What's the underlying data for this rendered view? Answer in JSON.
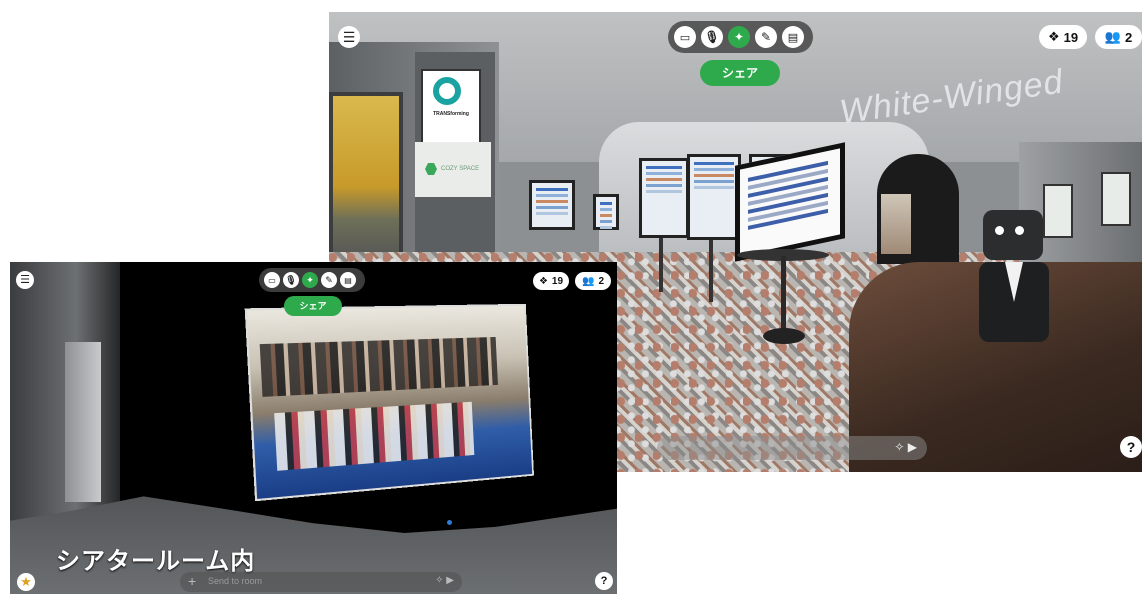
{
  "gallery": {
    "toolbar_icons": [
      "screen-icon",
      "mic-icon",
      "wand-icon",
      "pen-icon",
      "board-icon"
    ],
    "share_label": "シェア",
    "objects_count": "19",
    "users_count": "2",
    "banner_text": "White-Winged",
    "logo_text": "TRANSforming",
    "sign_text": "COZY SPACE",
    "help_label": "?"
  },
  "theater": {
    "toolbar_icons": [
      "screen-icon",
      "mic-icon",
      "wand-icon",
      "pen-icon",
      "board-icon"
    ],
    "share_label": "シェア",
    "objects_count": "19",
    "users_count": "2",
    "caption": "シアタールーム内",
    "chat_placeholder": "Send to room",
    "help_label": "?"
  },
  "colors": {
    "accent_green": "#2eaa4c",
    "hud_white": "#ffffff",
    "toolbar_bg": "#464646"
  }
}
